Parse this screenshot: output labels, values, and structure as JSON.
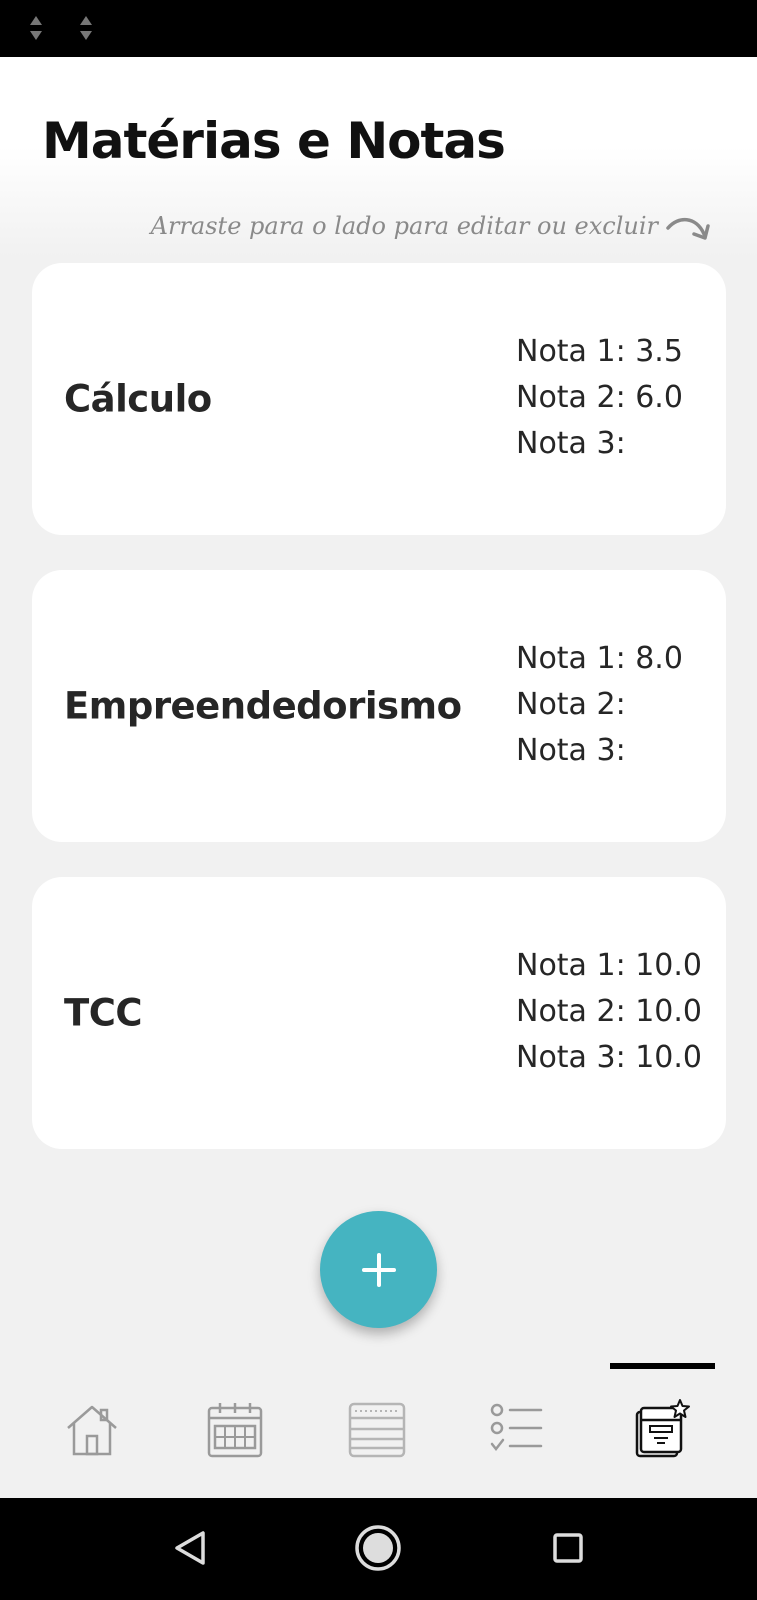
{
  "header": {
    "title": "Matérias e Notas",
    "hint": "Arraste para o lado para editar ou excluir"
  },
  "subjects": [
    {
      "name": "Cálculo",
      "grades": [
        "Nota 1: 3.5",
        "Nota 2: 6.0",
        "Nota 3:"
      ]
    },
    {
      "name": "Empreendedorismo",
      "grades": [
        "Nota 1: 8.0",
        "Nota 2:",
        "Nota 3:"
      ]
    },
    {
      "name": "TCC",
      "grades": [
        "Nota 1: 10.0",
        "Nota 2: 10.0",
        "Nota 3: 10.0"
      ]
    }
  ],
  "fab": {
    "icon": "plus-icon",
    "color": "#45b4c1"
  },
  "bottom_nav": {
    "items": [
      {
        "icon": "home-icon",
        "active": false
      },
      {
        "icon": "calendar-icon",
        "active": false
      },
      {
        "icon": "notebook-icon",
        "active": false
      },
      {
        "icon": "checklist-icon",
        "active": false
      },
      {
        "icon": "grades-book-icon",
        "active": true
      }
    ]
  },
  "system_nav": [
    "back-icon",
    "home-circle-icon",
    "recents-icon"
  ]
}
